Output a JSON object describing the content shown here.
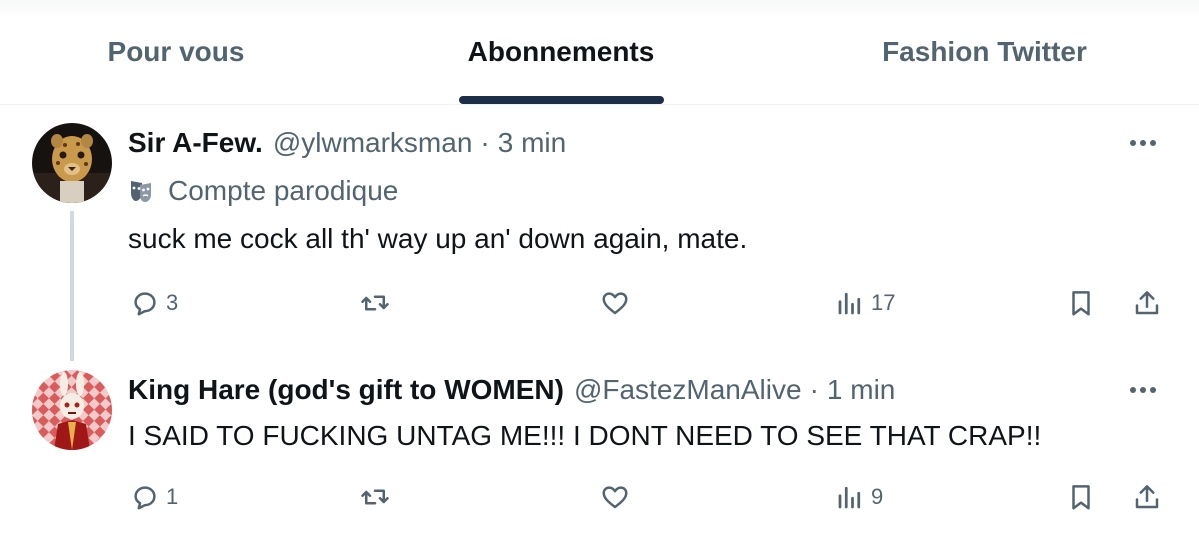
{
  "tabs": [
    {
      "label": "Pour vous",
      "active": false
    },
    {
      "label": "Abonnements",
      "active": true
    },
    {
      "label": "Fashion Twitter",
      "active": false
    }
  ],
  "colors": {
    "accent": "#1d2e48",
    "text": "#0f1419",
    "muted": "#536471",
    "thread_line": "#cfd9de"
  },
  "tweets": [
    {
      "display_name": "Sir A-Few.",
      "handle": "@ylwmarksman",
      "separator": "·",
      "time": "3 min",
      "badge": {
        "icon": "parody-mask-icon",
        "label": "Compte parodique"
      },
      "text": "suck me cock all th' way up an' down again, mate.",
      "replies": "3",
      "retweets": "",
      "likes": "",
      "views": "17",
      "avatar": "leopard-mask-avatar"
    },
    {
      "display_name": "King Hare (god's gift to WOMEN)",
      "handle": "@FastezManAlive",
      "separator": "·",
      "time": "1 min",
      "text": "I SAID TO FUCKING UNTAG ME!!! I DONT NEED TO SEE THAT CRAP!!",
      "replies": "1",
      "retweets": "",
      "likes": "",
      "views": "9",
      "avatar": "rabbit-king-avatar"
    }
  ]
}
